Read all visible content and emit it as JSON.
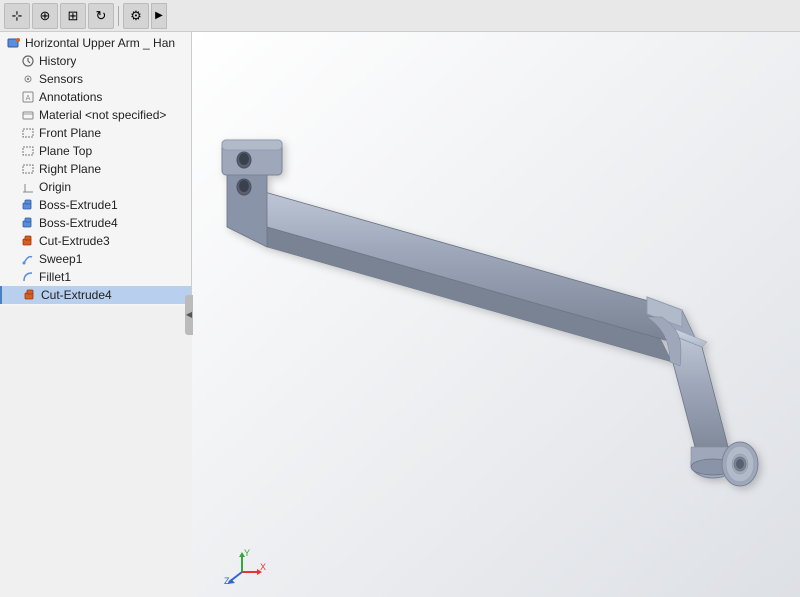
{
  "toolbar": {
    "buttons": [
      {
        "name": "pointer",
        "icon": "⊹",
        "label": "Select"
      },
      {
        "name": "zoom",
        "icon": "⊕",
        "label": "Zoom"
      },
      {
        "name": "pan",
        "icon": "✥",
        "label": "Pan"
      },
      {
        "name": "rotate",
        "icon": "↻",
        "label": "Rotate"
      },
      {
        "name": "settings",
        "icon": "⚙",
        "label": "Settings"
      }
    ],
    "more_arrow": "▶"
  },
  "feature_tree": {
    "root": {
      "label": "Horizontal Upper Arm _ Han",
      "icon": "part"
    },
    "items": [
      {
        "id": "history",
        "label": "History",
        "icon": "clock",
        "indent": 1,
        "selected": false
      },
      {
        "id": "sensors",
        "label": "Sensors",
        "icon": "sensor",
        "indent": 1
      },
      {
        "id": "annotations",
        "label": "Annotations",
        "icon": "annotation",
        "indent": 1
      },
      {
        "id": "material",
        "label": "Material <not specified>",
        "icon": "material",
        "indent": 1
      },
      {
        "id": "front-plane",
        "label": "Front Plane",
        "icon": "plane",
        "indent": 1
      },
      {
        "id": "top-plane",
        "label": "Plane Top",
        "icon": "plane",
        "indent": 1
      },
      {
        "id": "right-plane",
        "label": "Right Plane",
        "icon": "plane",
        "indent": 1
      },
      {
        "id": "origin",
        "label": "Origin",
        "icon": "origin",
        "indent": 1
      },
      {
        "id": "boss-extrude1",
        "label": "Boss-Extrude1",
        "icon": "extrude",
        "indent": 1
      },
      {
        "id": "boss-extrude4",
        "label": "Boss-Extrude4",
        "icon": "extrude",
        "indent": 1
      },
      {
        "id": "cut-extrude3",
        "label": "Cut-Extrude3",
        "icon": "cut",
        "indent": 1
      },
      {
        "id": "sweep1",
        "label": "Sweep1",
        "icon": "sweep",
        "indent": 1
      },
      {
        "id": "fillet1",
        "label": "Fillet1",
        "icon": "fillet",
        "indent": 1
      },
      {
        "id": "cut-extrude4",
        "label": "Cut-Extrude4",
        "icon": "cut",
        "indent": 1,
        "highlighted": true
      }
    ]
  },
  "axis": {
    "x_color": "#e63333",
    "y_color": "#33aa33",
    "z_color": "#3366cc",
    "x_label": "X",
    "y_label": "Y",
    "z_label": "Z"
  },
  "colors": {
    "model_fill": "#9fa8ba",
    "model_stroke": "#6b7585",
    "model_highlight": "#b0bac8",
    "background_top": "#ffffff",
    "background_bottom": "#dde0e5"
  }
}
